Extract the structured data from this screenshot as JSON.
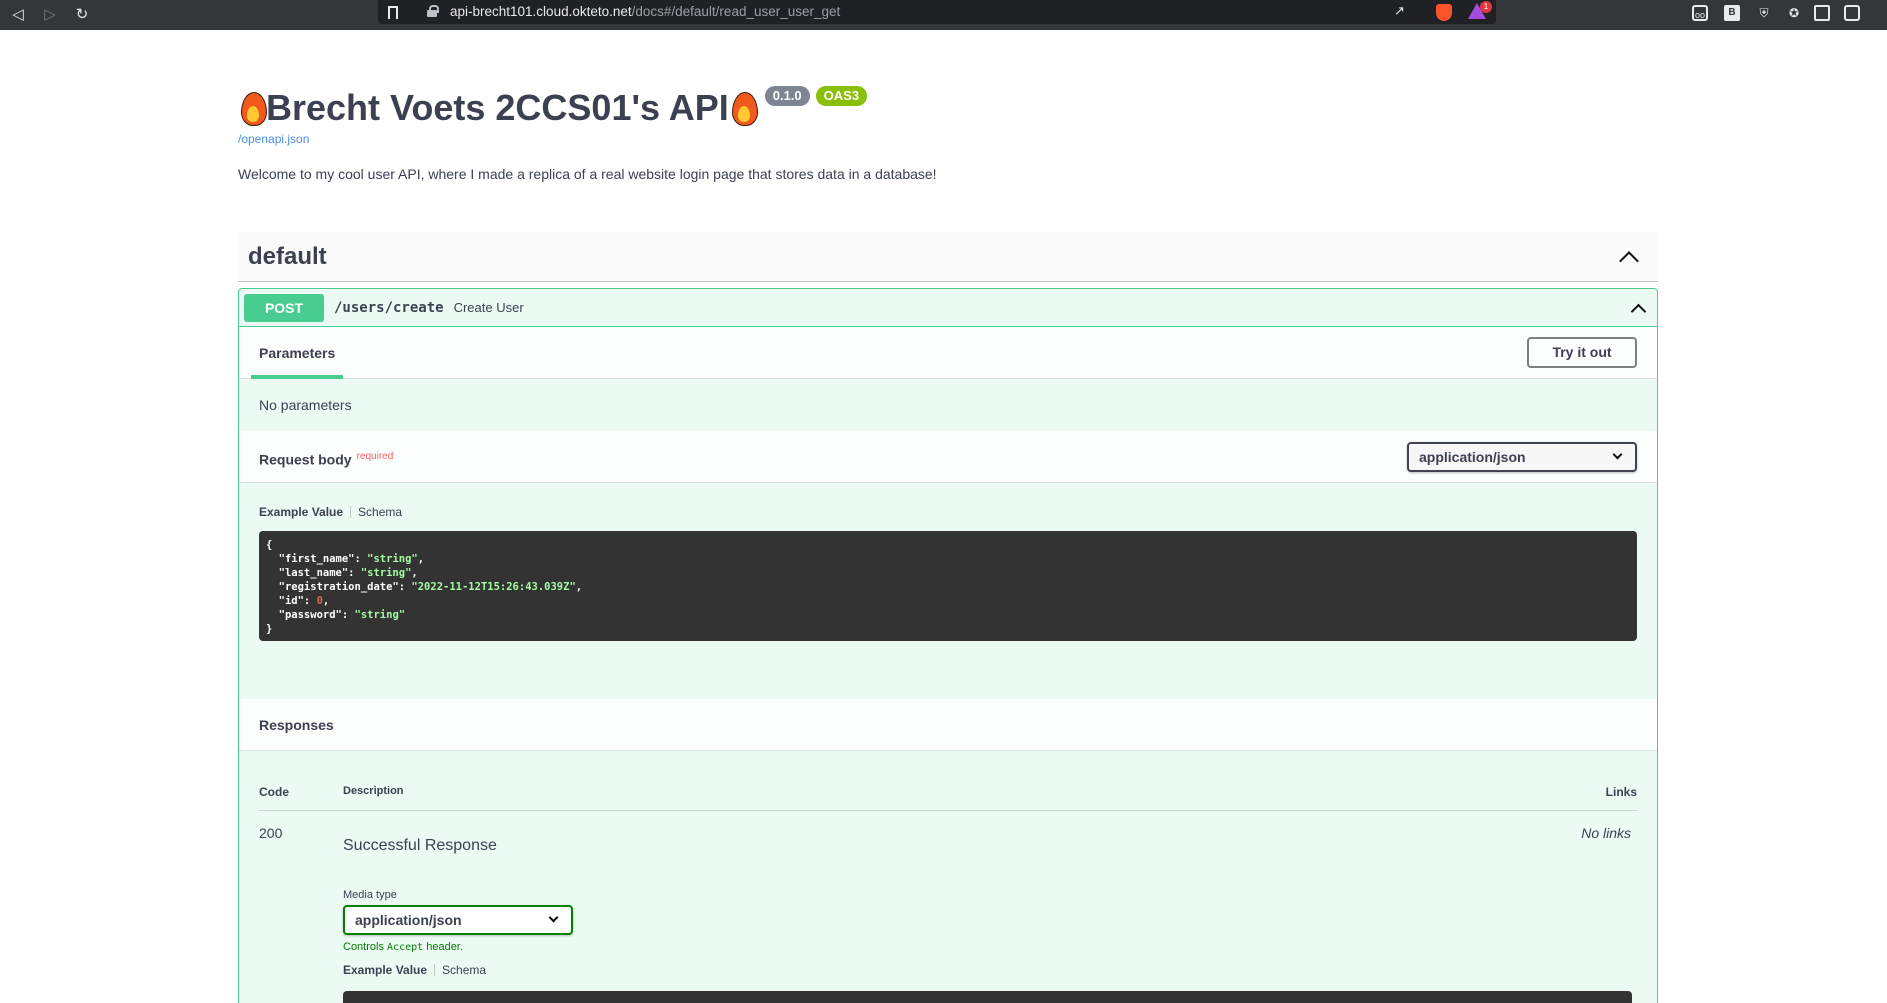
{
  "browser": {
    "url_host": "api-brecht101.cloud.okteto.net",
    "url_path": "/docs#/default/read_user_user_get",
    "rewards_count": "1",
    "extension_b_label": "B"
  },
  "info": {
    "title": "Brecht Voets 2CCS01's API",
    "version": "0.1.0",
    "oas": "OAS3",
    "spec_link": "/openapi.json",
    "description": "Welcome to my cool user API, where I made a replica of a real website login page that stores data in a database!"
  },
  "tag": {
    "name": "default"
  },
  "operation": {
    "method": "POST",
    "path": "/users/create",
    "summary": "Create User",
    "parameters_tab": "Parameters",
    "try_button": "Try it out",
    "no_params": "No parameters",
    "request_body_label": "Request body",
    "required_label": "required",
    "content_type": "application/json",
    "example_value_tab": "Example Value",
    "schema_tab": "Schema",
    "example_lines": [
      {
        "key": "\"first_name\"",
        "value": "\"string\"",
        "kind": "str",
        "trail": ","
      },
      {
        "key": "\"last_name\"",
        "value": "\"string\"",
        "kind": "str",
        "trail": ","
      },
      {
        "key": "\"registration_date\"",
        "value": "\"2022-11-12T15:26:43.039Z\"",
        "kind": "str",
        "trail": ","
      },
      {
        "key": "\"id\"",
        "value": "0",
        "kind": "num",
        "trail": ","
      },
      {
        "key": "\"password\"",
        "value": "\"string\"",
        "kind": "str",
        "trail": ""
      }
    ]
  },
  "responses": {
    "header": "Responses",
    "col_code": "Code",
    "col_description": "Description",
    "col_links": "Links",
    "rows": [
      {
        "code": "200",
        "description": "Successful Response",
        "links": "No links",
        "media_type_label": "Media type",
        "media_type": "application/json",
        "controls_prefix": "Controls",
        "controls_code": "Accept",
        "controls_suffix": "header.",
        "example_value_tab": "Example Value",
        "schema_tab": "Schema"
      }
    ]
  }
}
